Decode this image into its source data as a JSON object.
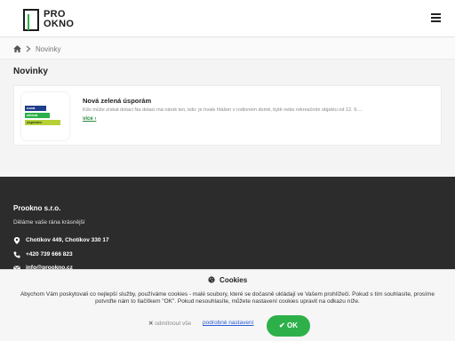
{
  "header": {
    "logo_line1": "PRO",
    "logo_line2": "OKNO"
  },
  "breadcrumb": {
    "current": "Novinky"
  },
  "page": {
    "title": "Novinky"
  },
  "news": [
    {
      "thumb_labels": [
        "nová",
        "zelená",
        "úsporám"
      ],
      "title": "Nová zelená úsporám",
      "excerpt": "Kdo může získat dotaci Na dotaci má nárok ten, kdo: je trvale hlášen v rodinném domě, bytě nebo rekreačním objektu od 12. 9....",
      "more": "více"
    }
  ],
  "footer": {
    "company": "Prookno s.r.o.",
    "tagline": "Děláme vaše rána krásnější",
    "address": "Chotíkov 449, Chotíkov 330 17",
    "phone": "+420 739 666 823",
    "email": "info@prookno.cz"
  },
  "cookies": {
    "title": "Cookies",
    "text": "Abychom Vám poskytovali co nejlepší služby, používáme cookies - malé soubory, které se dočasně ukládají ve Vašem prohlížeči. Pokud s tím souhlasíte, prosíme potvrďte nám to tlačítkem \"OK\". Pokud nesouhlasíte, můžete nastavení cookies upravit na odkazu níže.",
    "reject": "odmítnout vše",
    "settings": "podrobné nastavení",
    "ok": "OK"
  },
  "colors": {
    "brand_green": "#2db04a",
    "footer_bg": "#2c2c2c",
    "link_blue": "#2a5bd7"
  },
  "icons": [
    "menu-icon",
    "home-icon",
    "chevron-right-icon",
    "location-icon",
    "phone-icon",
    "email-icon",
    "cookie-icon",
    "close-icon",
    "check-icon"
  ]
}
